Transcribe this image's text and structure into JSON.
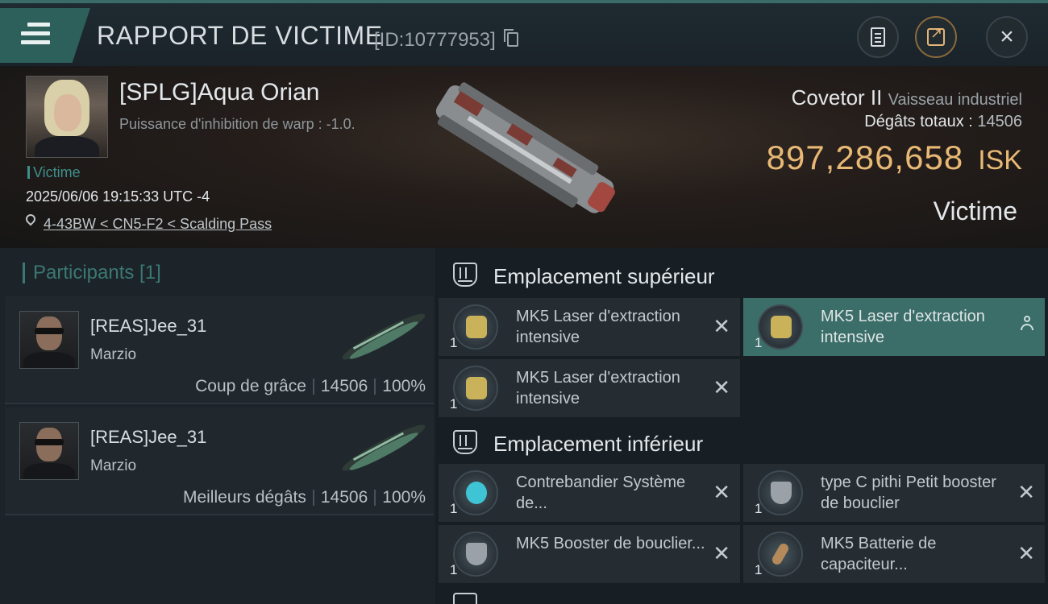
{
  "header": {
    "title": "RAPPORT DE VICTIME",
    "report_id": "[ID:10777953]"
  },
  "victim": {
    "name": "[SPLG]Aqua Orian",
    "warp_line": "Puissance d'inhibition de warp : -1.0.",
    "tag": "Victime",
    "timestamp": "2025/06/06 19:15:33 UTC -4",
    "location": "4-43BW < CN5-F2 < Scalding Pass",
    "ship_name": "Covetor II",
    "ship_type": "Vaisseau industriel",
    "damage_label": "Dégâts totaux :",
    "damage_value": "14506",
    "isk_value": "897,286,658",
    "isk_unit": "ISK",
    "role_label": "Victime"
  },
  "participants": {
    "title": "Participants [1]",
    "items": [
      {
        "name": "[REAS]Jee_31",
        "ship": "Marzio",
        "label": "Coup de grâce",
        "damage": "14506",
        "percent": "100%"
      },
      {
        "name": "[REAS]Jee_31",
        "ship": "Marzio",
        "label": "Meilleurs dégâts",
        "damage": "14506",
        "percent": "100%"
      }
    ]
  },
  "fitting": {
    "high_slot_label": "Emplacement supérieur",
    "low_slot_label": "Emplacement inférieur",
    "high_modules": [
      {
        "qty": "1",
        "name": "MK5 Laser d'extraction intensive",
        "status": "destroyed"
      },
      {
        "qty": "1",
        "name": "MK5 Laser d'extraction intensive",
        "status": "dropped"
      },
      {
        "qty": "1",
        "name": "MK5 Laser d'extraction intensive",
        "status": "destroyed"
      }
    ],
    "low_modules": [
      {
        "qty": "1",
        "name": "Contrebandier Système de...",
        "status": "destroyed"
      },
      {
        "qty": "1",
        "name": "type C pithi Petit booster de bouclier",
        "status": "destroyed"
      },
      {
        "qty": "1",
        "name": "MK5 Booster de bouclier...",
        "status": "destroyed"
      },
      {
        "qty": "1",
        "name": "MK5 Batterie de capaciteur...",
        "status": "destroyed"
      }
    ]
  },
  "icons": {
    "close": "×",
    "destroyed": "✕"
  },
  "colors": {
    "accent": "#3b6d69",
    "isk": "#e8b875",
    "teal_text": "#3b7873"
  }
}
